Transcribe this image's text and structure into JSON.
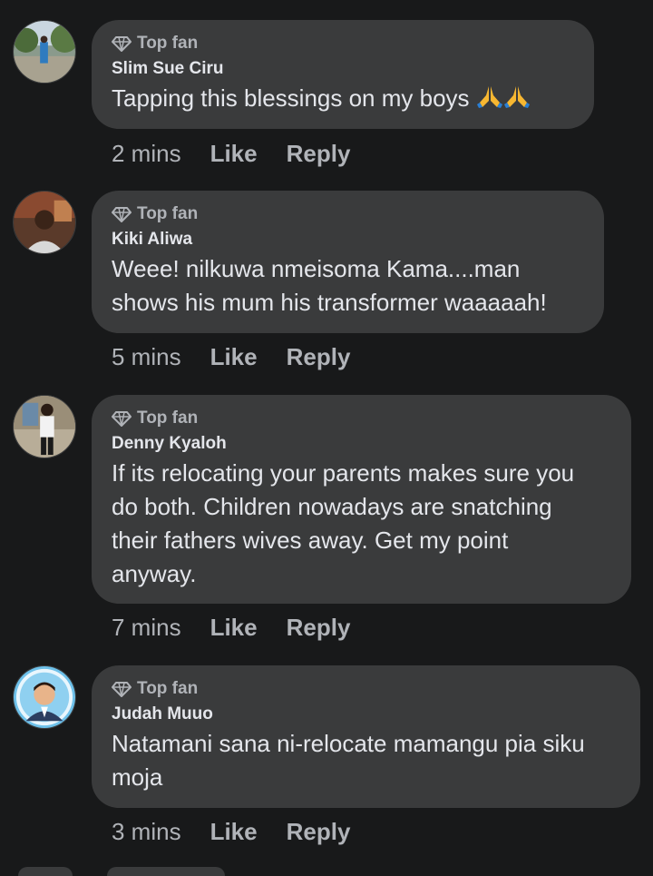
{
  "comments": [
    {
      "badge": "Top fan",
      "author": "Slim Sue Ciru",
      "text": "Tapping this blessings on my boys",
      "emoji": "🙏🙏",
      "time": "2 mins",
      "like": "Like",
      "reply": "Reply"
    },
    {
      "badge": "Top fan",
      "author": "Kiki Aliwa",
      "text": "Weee! nilkuwa nmeisoma Kama....man\nshows his mum his transformer waaaaah!",
      "time": "5 mins",
      "like": "Like",
      "reply": "Reply"
    },
    {
      "badge": "Top fan",
      "author": "Denny Kyaloh",
      "text": "If its relocating your parents makes sure you\ndo both. Children nowadays are snatching\ntheir fathers wives away. Get my point\nanyway.",
      "time": "7 mins",
      "like": "Like",
      "reply": "Reply"
    },
    {
      "badge": "Top fan",
      "author": "Judah Muuo",
      "text": "Natamani sana ni-relocate mamangu pia siku\nmoja",
      "time": "3 mins",
      "like": "Like",
      "reply": "Reply"
    }
  ],
  "colors": {
    "background": "#18191a",
    "bubble": "#3a3b3c",
    "primary_text": "#e4e6eb",
    "secondary_text": "#b0b3b8"
  },
  "icons": {
    "badge": "diamond-icon",
    "emoji": "folded-hands-icon"
  }
}
